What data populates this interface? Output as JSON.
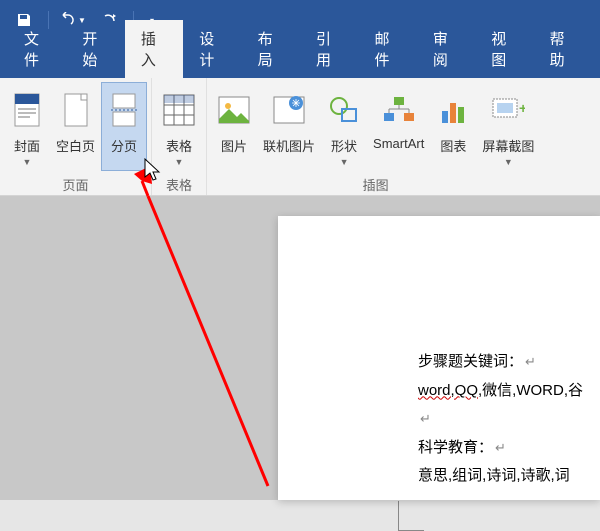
{
  "qat": {
    "save": "save-icon",
    "undo": "undo-icon",
    "redo": "redo-icon"
  },
  "tabs": {
    "file": "文件",
    "home": "开始",
    "insert": "插入",
    "design": "设计",
    "layout": "布局",
    "references": "引用",
    "mailings": "邮件",
    "review": "审阅",
    "view": "视图",
    "help": "帮助"
  },
  "ribbon": {
    "pages_group": "页面",
    "tables_group": "表格",
    "illustrations_group": "插图",
    "cover_page": "封面",
    "blank_page": "空白页",
    "page_break": "分页",
    "table": "表格",
    "pictures": "图片",
    "online_pictures": "联机图片",
    "shapes": "形状",
    "smartart": "SmartArt",
    "chart": "图表",
    "screenshot": "屏幕截图"
  },
  "document": {
    "line1_prefix": "步骤题关键词：",
    "line2_spell": "word,QQ",
    "line2_rest": ",微信,WORD,谷",
    "line3": "科学教育：",
    "line4": "意思,组词,诗词,诗歌,词"
  },
  "colors": {
    "brand": "#2b579a",
    "ribbon_bg": "#f3f3f3",
    "arrow": "#ff0000"
  }
}
